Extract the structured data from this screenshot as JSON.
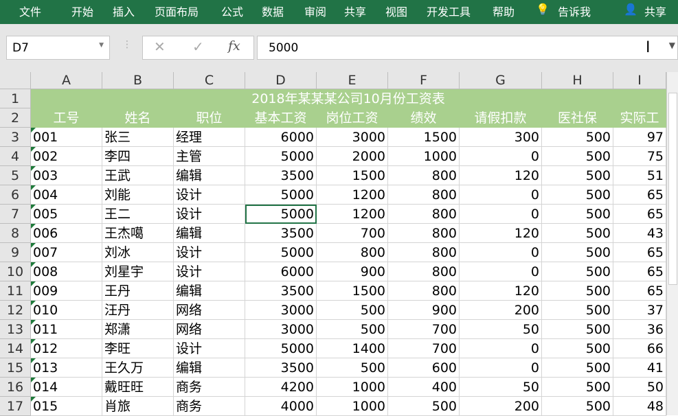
{
  "ribbon": {
    "tabs": [
      "文件",
      "开始",
      "插入",
      "页面布局",
      "公式",
      "数据",
      "审阅",
      "共享",
      "视图",
      "开发工具",
      "帮助"
    ],
    "tell_me": "告诉我",
    "share": "共享",
    "color": "#217346"
  },
  "formula_bar": {
    "name_box": "D7",
    "formula": "5000",
    "cancel_icon": "✕",
    "enter_icon": "✓",
    "fx_label": "fx"
  },
  "sheet": {
    "columns": [
      "A",
      "B",
      "C",
      "D",
      "E",
      "F",
      "G",
      "H",
      "I"
    ],
    "title": "2018年某某某公司10月份工资表",
    "headers": [
      "工号",
      "姓名",
      "职位",
      "基本工资",
      "岗位工资",
      "绩效",
      "请假扣款",
      "医社保",
      "实际工"
    ],
    "header_color": "#a9d08e",
    "rows": [
      [
        "001",
        "张三",
        "经理",
        "6000",
        "3000",
        "1500",
        "300",
        "500",
        "97"
      ],
      [
        "002",
        "李四",
        "主管",
        "5000",
        "2000",
        "1000",
        "0",
        "500",
        "75"
      ],
      [
        "003",
        "王武",
        "编辑",
        "3500",
        "1500",
        "800",
        "120",
        "500",
        "51"
      ],
      [
        "004",
        "刘能",
        "设计",
        "5000",
        "1200",
        "800",
        "0",
        "500",
        "65"
      ],
      [
        "005",
        "王二",
        "设计",
        "5000",
        "1200",
        "800",
        "0",
        "500",
        "65"
      ],
      [
        "006",
        "王杰噶",
        "编辑",
        "3500",
        "700",
        "800",
        "120",
        "500",
        "43"
      ],
      [
        "007",
        "刘冰",
        "设计",
        "5000",
        "800",
        "800",
        "0",
        "500",
        "65"
      ],
      [
        "008",
        "刘星宇",
        "设计",
        "6000",
        "900",
        "800",
        "0",
        "500",
        "65"
      ],
      [
        "009",
        "王丹",
        "编辑",
        "3500",
        "1500",
        "800",
        "120",
        "500",
        "65"
      ],
      [
        "010",
        "汪丹",
        "网络",
        "3000",
        "500",
        "900",
        "200",
        "500",
        "37"
      ],
      [
        "011",
        "郑潇",
        "网络",
        "3000",
        "500",
        "700",
        "50",
        "500",
        "36"
      ],
      [
        "012",
        "李旺",
        "设计",
        "5000",
        "1400",
        "700",
        "0",
        "500",
        "66"
      ],
      [
        "013",
        "王久万",
        "编辑",
        "3500",
        "500",
        "600",
        "0",
        "500",
        "41"
      ],
      [
        "014",
        "戴旺旺",
        "商务",
        "4200",
        "1000",
        "400",
        "50",
        "500",
        "50"
      ],
      [
        "015",
        "肖旅",
        "商务",
        "4000",
        "1000",
        "500",
        "200",
        "500",
        "48"
      ]
    ]
  }
}
